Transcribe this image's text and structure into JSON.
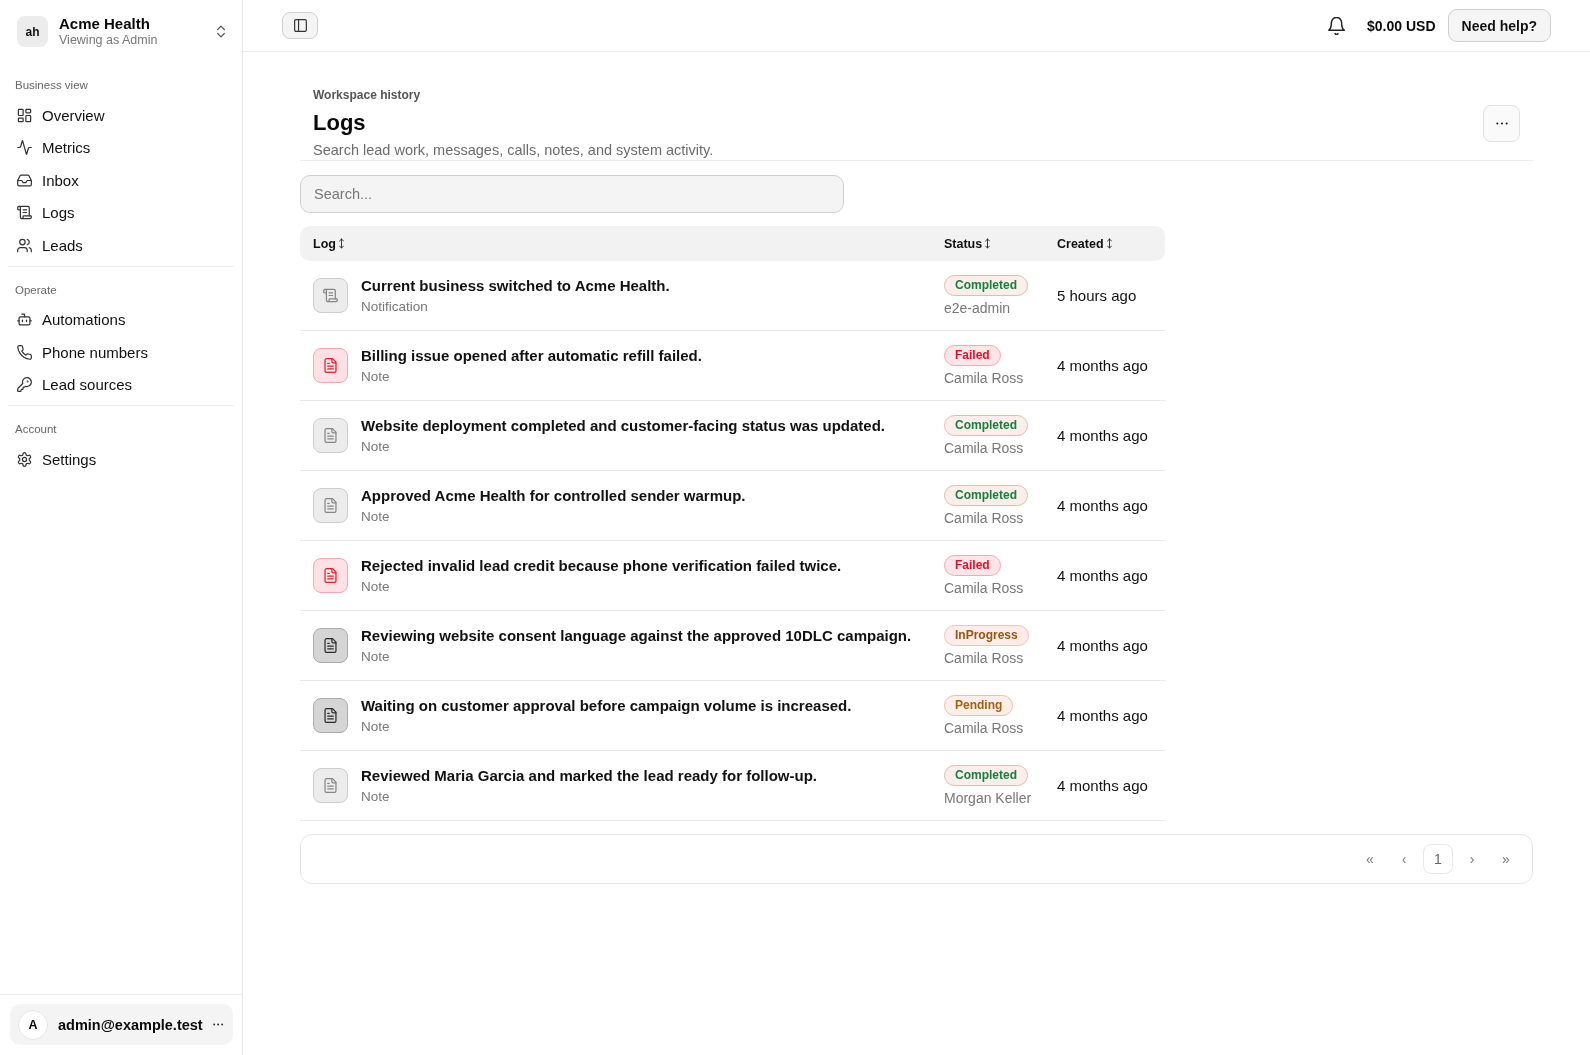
{
  "sidebar": {
    "org": {
      "initials": "ah",
      "name": "Acme Health",
      "subtitle": "Viewing as Admin"
    },
    "sections": [
      {
        "label": "Business view",
        "items": [
          {
            "label": "Overview",
            "selected": false
          },
          {
            "label": "Metrics",
            "selected": false
          },
          {
            "label": "Inbox",
            "selected": false
          },
          {
            "label": "Logs",
            "selected": false
          },
          {
            "label": "Leads",
            "selected": false
          }
        ]
      },
      {
        "label": "Operate",
        "items": [
          {
            "label": "Automations",
            "selected": false
          },
          {
            "label": "Phone numbers",
            "selected": false
          },
          {
            "label": "Lead sources",
            "selected": false
          }
        ]
      },
      {
        "label": "Account",
        "items": [
          {
            "label": "Settings",
            "selected": false
          }
        ]
      }
    ],
    "user": {
      "initial": "A",
      "email": "admin@example.test"
    }
  },
  "topbar": {
    "balance": "$0.00 USD",
    "help_button": "Need help?"
  },
  "header": {
    "eyebrow": "Workspace history",
    "title": "Logs",
    "subtitle": "Search lead work, messages, calls, notes, and system activity."
  },
  "search": {
    "placeholder": "Search..."
  },
  "table": {
    "columns": [
      "Log",
      "Status",
      "Created"
    ],
    "rows": [
      {
        "kind": "notification",
        "title": "Current business switched to Acme Health.",
        "type": "Notification",
        "status": {
          "label": "Completed",
          "kind": "completed"
        },
        "actor": "e2e-admin",
        "created": "5 hours ago"
      },
      {
        "kind": "note",
        "title": "Billing issue opened after automatic refill failed.",
        "type": "Note",
        "status": {
          "label": "Failed",
          "kind": "failed"
        },
        "actor": "Camila Ross",
        "created": "4 months ago"
      },
      {
        "kind": "note",
        "title": "Website deployment completed and customer-facing status was updated.",
        "type": "Note",
        "status": {
          "label": "Completed",
          "kind": "completed"
        },
        "actor": "Camila Ross",
        "created": "4 months ago"
      },
      {
        "kind": "note",
        "title": "Approved Acme Health for controlled sender warmup.",
        "type": "Note",
        "status": {
          "label": "Completed",
          "kind": "completed"
        },
        "actor": "Camila Ross",
        "created": "4 months ago"
      },
      {
        "kind": "note",
        "title": "Rejected invalid lead credit because phone verification failed twice.",
        "type": "Note",
        "status": {
          "label": "Failed",
          "kind": "failed"
        },
        "actor": "Camila Ross",
        "created": "4 months ago"
      },
      {
        "kind": "note",
        "title": "Reviewing website consent language against the approved 10DLC campaign.",
        "type": "Note",
        "status": {
          "label": "InProgress",
          "kind": "progress"
        },
        "actor": "Camila Ross",
        "created": "4 months ago"
      },
      {
        "kind": "note",
        "title": "Waiting on customer approval before campaign volume is increased.",
        "type": "Note",
        "status": {
          "label": "Pending",
          "kind": "pending"
        },
        "actor": "Camila Ross",
        "created": "4 months ago"
      },
      {
        "kind": "note",
        "title": "Reviewed Maria Garcia and marked the lead ready for follow-up.",
        "type": "Note",
        "status": {
          "label": "Completed",
          "kind": "completed"
        },
        "actor": "Morgan Keller",
        "created": "4 months ago"
      }
    ]
  },
  "pagination": {
    "first": "«",
    "previous": "‹",
    "pages": [
      {
        "label": "1",
        "selected": true
      }
    ],
    "next": "›",
    "last": "»"
  }
}
